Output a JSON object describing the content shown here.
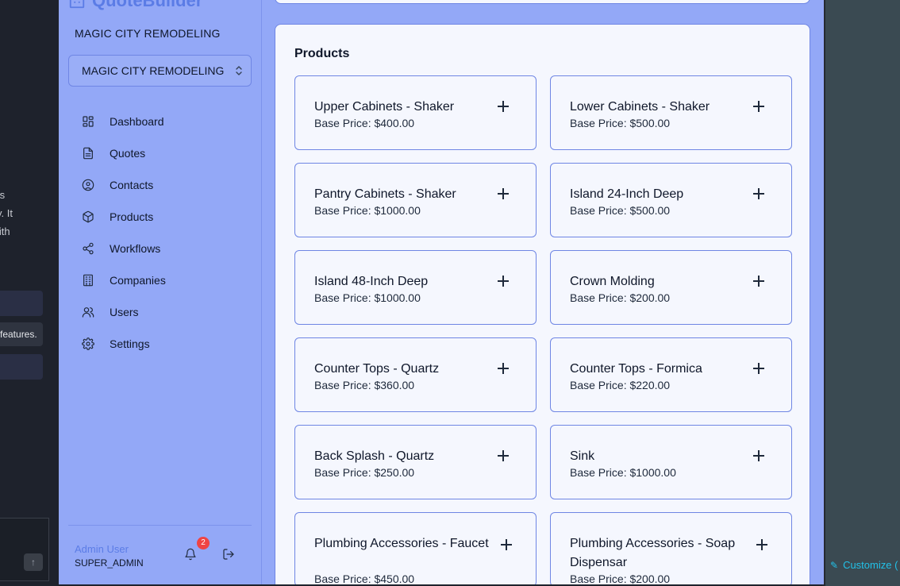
{
  "background_left": {
    "text_lines": [
      "iew its",
      "tically. It",
      "ws with"
    ],
    "badge": "features."
  },
  "background_right": {
    "customize_label": "Customize ("
  },
  "sidebar": {
    "logo_text": "QuoteBuilder",
    "company_name": "MAGIC CITY REMODELING",
    "company_select_value": "MAGIC CITY REMODELING",
    "nav": [
      {
        "label": "Dashboard",
        "icon": "dashboard-icon"
      },
      {
        "label": "Quotes",
        "icon": "document-icon"
      },
      {
        "label": "Contacts",
        "icon": "user-circle-icon"
      },
      {
        "label": "Products",
        "icon": "package-icon"
      },
      {
        "label": "Workflows",
        "icon": "share-icon"
      },
      {
        "label": "Companies",
        "icon": "building-icon"
      },
      {
        "label": "Users",
        "icon": "users-icon"
      },
      {
        "label": "Settings",
        "icon": "gear-icon"
      }
    ],
    "footer": {
      "user_name": "Admin User",
      "user_role": "SUPER_ADMIN",
      "notification_count": "2"
    }
  },
  "products": {
    "title": "Products",
    "items": [
      {
        "name": "Upper Cabinets - Shaker",
        "price": "Base Price: $400.00"
      },
      {
        "name": "Lower Cabinets - Shaker",
        "price": "Base Price: $500.00"
      },
      {
        "name": "Pantry Cabinets - Shaker",
        "price": "Base Price: $1000.00"
      },
      {
        "name": "Island 24-Inch Deep",
        "price": "Base Price: $500.00"
      },
      {
        "name": "Island 48-Inch Deep",
        "price": "Base Price: $1000.00"
      },
      {
        "name": "Crown Molding",
        "price": "Base Price: $200.00"
      },
      {
        "name": "Counter Tops - Quartz",
        "price": "Base Price: $360.00"
      },
      {
        "name": "Counter Tops - Formica",
        "price": "Base Price: $220.00"
      },
      {
        "name": "Back Splash - Quartz",
        "price": "Base Price: $250.00"
      },
      {
        "name": "Sink",
        "price": "Base Price: $1000.00"
      },
      {
        "name": "Plumbing Accessories - Faucet",
        "price": "Base Price: $450.00"
      },
      {
        "name": "Plumbing Accessories - Soap Dispensar",
        "price": "Base Price: $200.00"
      }
    ]
  }
}
